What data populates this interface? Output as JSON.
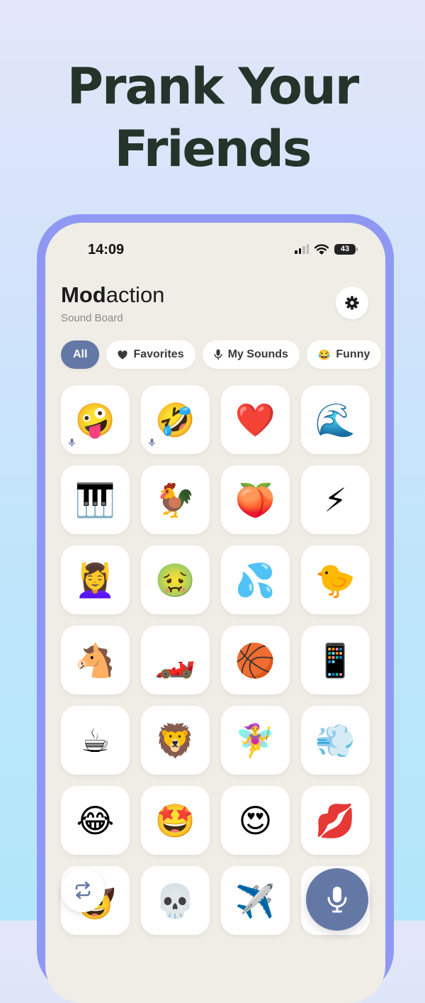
{
  "headline": {
    "line1": "Prank Your",
    "line2": "Friends"
  },
  "status_bar": {
    "time": "14:09",
    "battery": "43"
  },
  "app": {
    "title_bold": "Mod",
    "title_rest": "action",
    "subtitle": "Sound Board"
  },
  "tabs": [
    {
      "label": "All",
      "icon": ""
    },
    {
      "label": "Favorites",
      "icon": "heart-icon"
    },
    {
      "label": "My Sounds",
      "icon": "mic-icon"
    },
    {
      "label": "Funny",
      "icon": "😂"
    }
  ],
  "sounds": [
    {
      "emoji": "🤪",
      "custom": true
    },
    {
      "emoji": "🤣",
      "custom": true
    },
    {
      "emoji": "❤️",
      "custom": false
    },
    {
      "emoji": "🌊",
      "custom": false
    },
    {
      "emoji": "🎹",
      "custom": false
    },
    {
      "emoji": "🐓",
      "custom": false
    },
    {
      "emoji": "🍑",
      "custom": false
    },
    {
      "emoji": "⚡",
      "custom": false
    },
    {
      "emoji": "💆‍♀️",
      "custom": false
    },
    {
      "emoji": "🤢",
      "custom": false
    },
    {
      "emoji": "💦",
      "custom": false
    },
    {
      "emoji": "🐤",
      "custom": false
    },
    {
      "emoji": "🐴",
      "custom": false
    },
    {
      "emoji": "🏎️",
      "custom": false
    },
    {
      "emoji": "🏀",
      "custom": false
    },
    {
      "emoji": "📱",
      "custom": false
    },
    {
      "emoji": "☕",
      "custom": false
    },
    {
      "emoji": "🦁",
      "custom": false
    },
    {
      "emoji": "🧚‍♀️",
      "custom": false
    },
    {
      "emoji": "💨",
      "custom": false
    },
    {
      "emoji": "😂",
      "custom": false
    },
    {
      "emoji": "🤩",
      "custom": false
    },
    {
      "emoji": "😍",
      "custom": false
    },
    {
      "emoji": "💋",
      "custom": false
    },
    {
      "emoji": "🤠",
      "custom": false
    },
    {
      "emoji": "💀",
      "custom": false
    },
    {
      "emoji": "✈️",
      "custom": false
    },
    {
      "emoji": "",
      "custom": false
    }
  ],
  "colors": {
    "accent": "#6478a6",
    "frame": "#8f99f3",
    "headline": "#24342a",
    "screen": "#efede6"
  },
  "icons": {
    "settings": "gear-icon",
    "shuffle": "shuffle-icon",
    "record": "mic-icon"
  }
}
